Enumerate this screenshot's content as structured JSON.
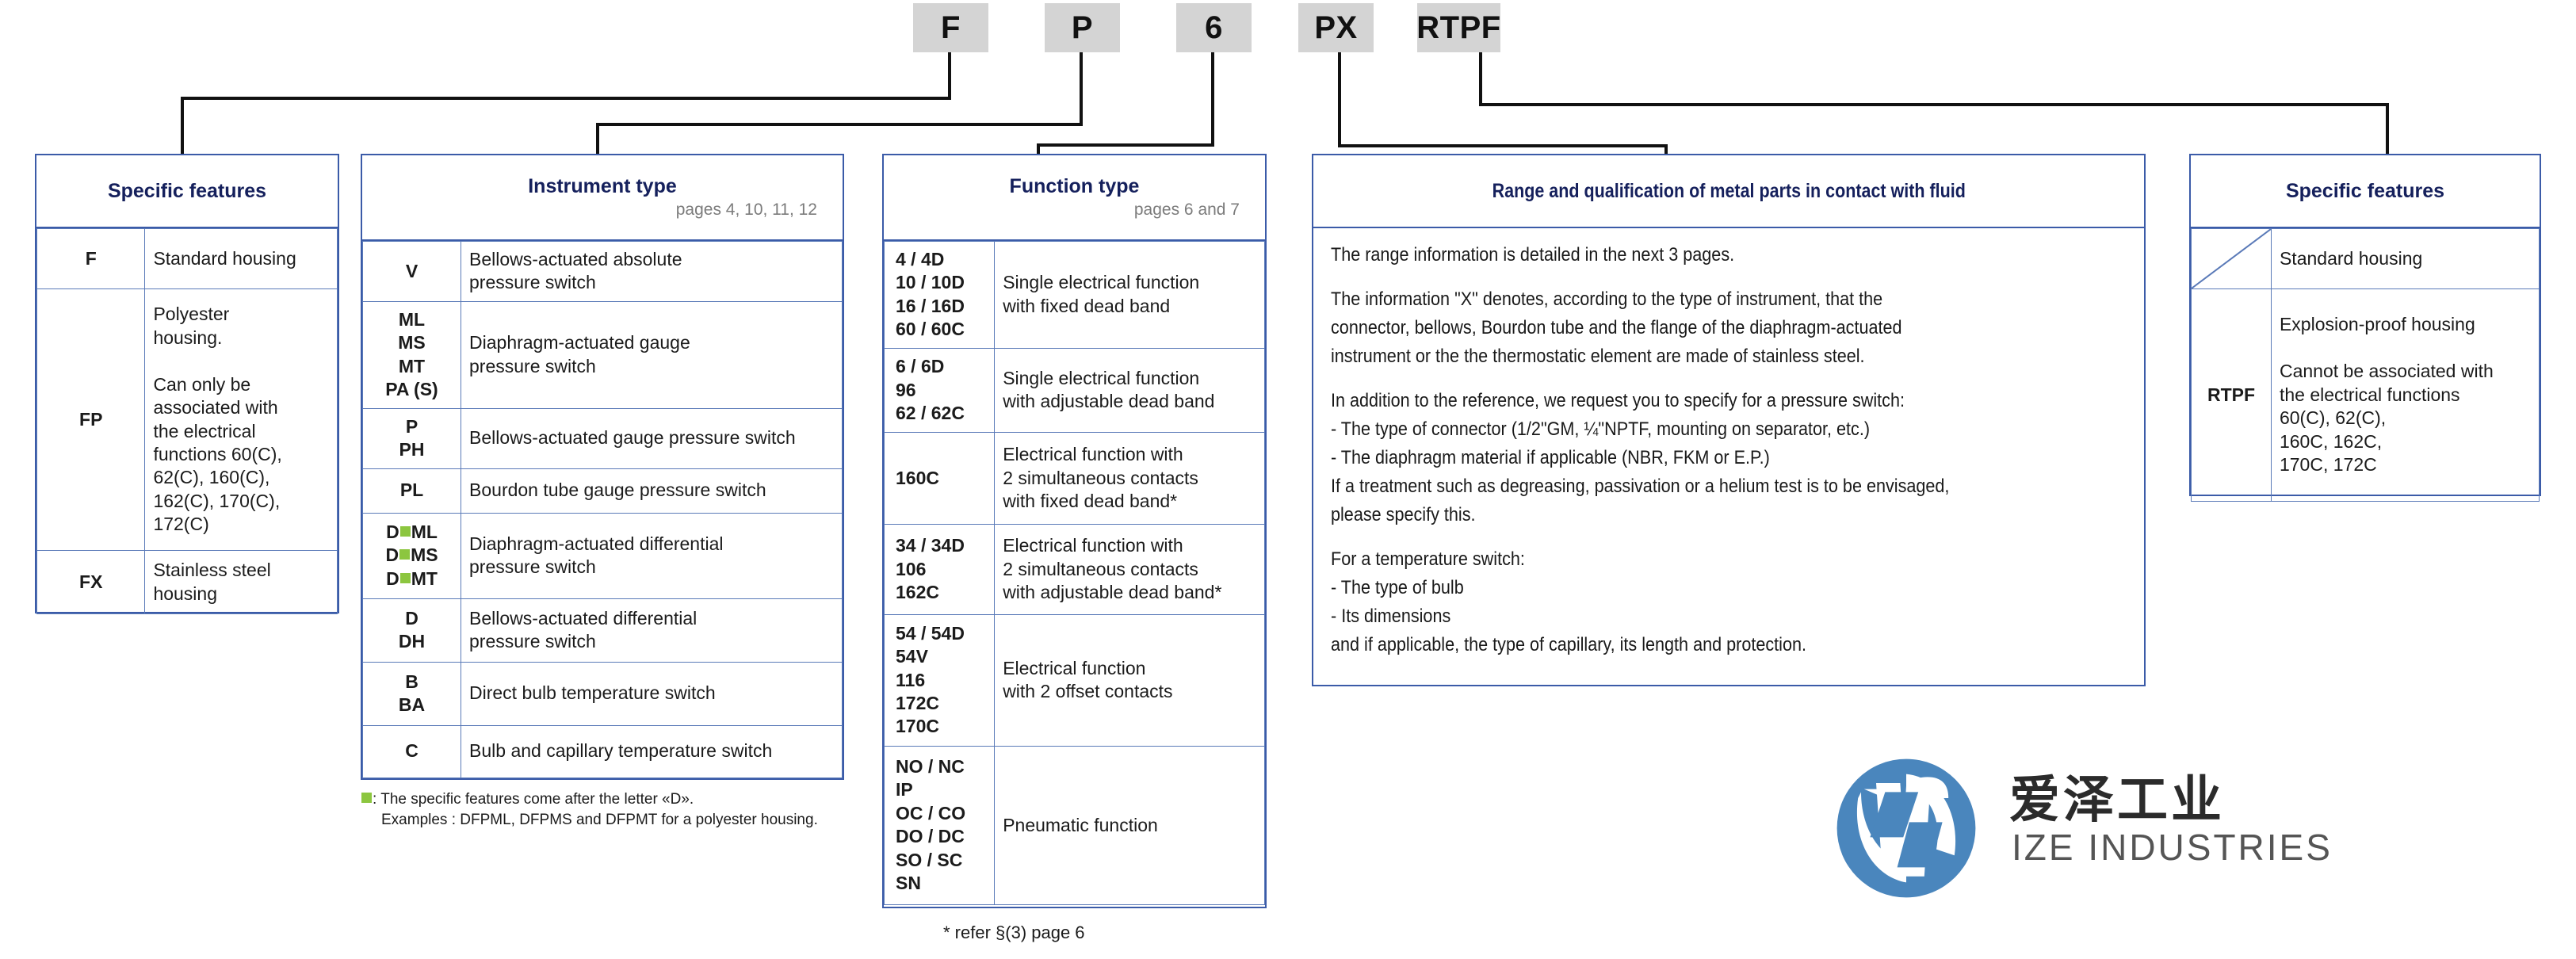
{
  "code_boxes": [
    {
      "label": "F"
    },
    {
      "label": "P"
    },
    {
      "label": "6"
    },
    {
      "label": "PX"
    },
    {
      "label": "RTPF"
    }
  ],
  "specific_features_left": {
    "title": "Specific features",
    "rows": [
      {
        "code": "F",
        "desc": "Standard housing"
      },
      {
        "code": "FP",
        "desc": "Polyester\nhousing.\n\nCan only be\nassociated with\nthe electrical\nfunctions 60(C),\n62(C), 160(C),\n162(C), 170(C),\n172(C)"
      },
      {
        "code": "FX",
        "desc": "Stainless steel\nhousing"
      }
    ]
  },
  "instrument_type": {
    "title": "Instrument type",
    "subtitle": "pages 4, 10, 11, 12",
    "rows": [
      {
        "code": "V",
        "desc": "Bellows-actuated absolute\npressure switch"
      },
      {
        "code": "ML\nMS\nMT\nPA (S)",
        "desc": "Diaphragm-actuated gauge\npressure switch"
      },
      {
        "code": "P\nPH",
        "desc": "Bellows-actuated gauge pressure switch"
      },
      {
        "code": "PL",
        "desc": "Bourdon tube gauge pressure switch"
      },
      {
        "code_marked": [
          "D|ML",
          "D|MS",
          "D|MT"
        ],
        "desc": "Diaphragm-actuated differential\npressure switch"
      },
      {
        "code": "D\nDH",
        "desc": "Bellows-actuated differential\npressure switch"
      },
      {
        "code": "B\nBA",
        "desc": "Direct bulb temperature switch"
      },
      {
        "code": "C",
        "desc": "Bulb and capillary temperature switch"
      }
    ],
    "note_line1": ": The specific features come after the letter «D».",
    "note_line2": "Examples : DFPML, DFPMS and DFPMT for a polyester housing.",
    "marker_color": "#8cc63f"
  },
  "function_type": {
    "title": "Function type",
    "subtitle": "pages 6 and 7",
    "rows": [
      {
        "code": "4 / 4D\n10 / 10D\n16 / 16D\n60 / 60C",
        "desc": "Single electrical function\nwith fixed dead band"
      },
      {
        "code": "6 / 6D\n96\n62 / 62C",
        "desc": "Single electrical function\nwith adjustable dead band"
      },
      {
        "code": "160C",
        "desc": "Electrical function with\n2 simultaneous contacts\nwith fixed dead band*"
      },
      {
        "code": "34 / 34D\n106\n162C",
        "desc": "Electrical function with\n2 simultaneous contacts\nwith adjustable dead band*"
      },
      {
        "code": "54 / 54D\n54V\n116\n172C\n170C",
        "desc": "Electrical function\nwith 2 offset contacts"
      },
      {
        "code": "NO / NC\nIP\nOC / CO\nDO / DC\nSO / SC\nSN",
        "desc": "Pneumatic function"
      }
    ],
    "footnote": "* refer §(3) page 6"
  },
  "range_panel": {
    "title": "Range and qualification of metal parts in contact with fluid",
    "paragraphs": [
      "The range information is detailed in the next 3 pages.",
      "The information \"X\" denotes, according to the type of instrument, that the\nconnector, bellows, Bourdon tube and the flange of the diaphragm-actuated\ninstrument or the the thermostatic element are made of stainless steel.",
      "In addition to the reference, we request you to specify for a pressure switch:\n- The type of connector (1/2\"GM, ¼\"NPTF, mounting on separator, etc.)\n- The diaphragm material if applicable (NBR, FKM or E.P.)\nIf a treatment such as degreasing, passivation or a helium test is to be envisaged,\nplease specify this.",
      "For a temperature switch:\n- The type of bulb\n- Its dimensions\nand if applicable, the type of capillary, its length and protection."
    ]
  },
  "specific_features_right": {
    "title": "Specific features",
    "rows": [
      {
        "code": "",
        "desc": "Standard housing",
        "slash": true
      },
      {
        "code": "RTPF",
        "desc": "Explosion-proof housing\n\nCannot be associated with\nthe electrical functions\n60(C), 62(C),\n160C, 162C,\n170C, 172C"
      }
    ]
  },
  "logo": {
    "cn_text": "爱泽工业",
    "en_text": "IZE INDUSTRIES",
    "mark_color": "#4a86bd"
  },
  "colors": {
    "table_border": "#3b5ba8",
    "inner_border": "#5a7ab8",
    "title_navy": "#15205c",
    "code_box_bg": "#d4d4d4",
    "connector": "#111111",
    "green_marker": "#8cc63f"
  }
}
